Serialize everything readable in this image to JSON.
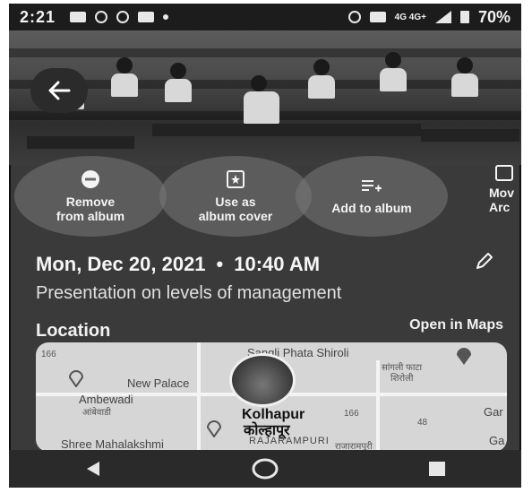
{
  "status_bar": {
    "time": "2:21",
    "network": "4G 4G+",
    "battery": "70%"
  },
  "actions": [
    {
      "label": "Remove\nfrom album",
      "icon": "minus-circle-icon"
    },
    {
      "label": "Use as\nalbum cover",
      "icon": "album-cover-icon"
    },
    {
      "label": "Add to album",
      "icon": "playlist-add-icon"
    },
    {
      "label": "Mov\nArc",
      "icon": "archive-icon"
    }
  ],
  "details": {
    "date": "Mon, Dec 20, 2021",
    "separator": "•",
    "time": "10:40 AM",
    "description": "Presentation on levels of management"
  },
  "location": {
    "title": "Location",
    "open_in_maps": "Open in Maps",
    "map_labels": {
      "sangli_phata": "Sangli Phata Shiroli",
      "sangli_phata_dev": "सांगली फाटा",
      "shiroli_dev": "शिरोली",
      "new_palace": "New Palace",
      "ambewadi": "Ambewadi",
      "ambewadi_dev": "आंबेवाडी",
      "kolhapur": "Kolhapur",
      "kolhapur_dev": "कोल्हापूर",
      "rajarampuri": "RAJARAMPURI",
      "rajarampuri_dev": "राजारामपुरी",
      "shree_mahalakshmi": "Shree Mahalakshmi",
      "road_166": "166",
      "road_166b": "166",
      "road_48": "48",
      "gar": "Gar",
      "ga": "Ga"
    }
  }
}
